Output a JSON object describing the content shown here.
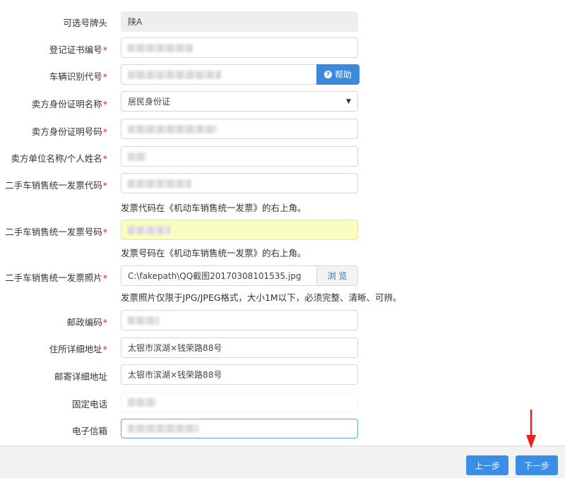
{
  "form": {
    "plate_prefix": {
      "label": "可选号牌头",
      "value": "陕A"
    },
    "cert_number": {
      "label": "登记证书编号",
      "required": "*"
    },
    "vin": {
      "label": "车辆识别代号",
      "required": "*",
      "help_label": "帮助"
    },
    "seller_id_type": {
      "label": "卖方身份证明名称",
      "required": "*",
      "selected": "居民身份证"
    },
    "seller_id_number": {
      "label": "卖方身份证明号码",
      "required": "*"
    },
    "seller_name": {
      "label": "卖方单位名称/个人姓名",
      "required": "*"
    },
    "invoice_code": {
      "label": "二手车销售统一发票代码",
      "required": "*",
      "hint": "发票代码在《机动车销售统一发票》的右上角。"
    },
    "invoice_number": {
      "label": "二手车销售统一发票号码",
      "required": "*",
      "hint": "发票号码在《机动车销售统一发票》的右上角。"
    },
    "invoice_photo": {
      "label": "二手车销售统一发票照片",
      "required": "*",
      "value": "C:\\fakepath\\QQ截图20170308101535.jpg",
      "browse_label": "浏 览",
      "hint": "发票照片仅限于JPG/JPEG格式，大小1M以下，必须完整、清晰、可辨。"
    },
    "postcode": {
      "label": "邮政编码",
      "required": "*"
    },
    "address": {
      "label": "住所详细地址",
      "required": "*",
      "value": "太银市滨湖×钱荣路88号"
    },
    "mail_address": {
      "label": "邮寄详细地址",
      "value": "太银市滨湖×钱荣路88号"
    },
    "phone": {
      "label": "固定电话"
    },
    "email": {
      "label": "电子信箱"
    }
  },
  "footer": {
    "prev_label": "上一步",
    "next_label": "下一步"
  },
  "colors": {
    "primary": "#3a8ee6",
    "required": "#e02020",
    "highlight": "#fafdc0",
    "arrow": "#e8231b"
  }
}
